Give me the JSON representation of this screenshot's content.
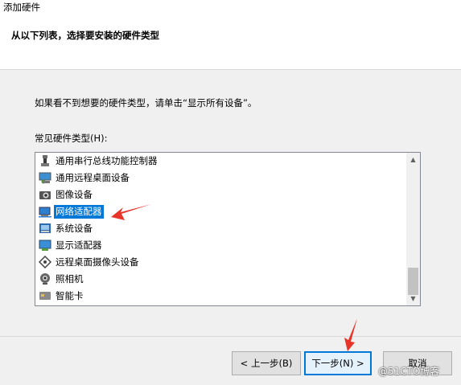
{
  "window": {
    "title": "添加硬件"
  },
  "header": {
    "title": "从以下列表，选择要安装的硬件类型"
  },
  "instruction": "如果看不到想要的硬件类型，请单击“显示所有设备”。",
  "list": {
    "label": "常见硬件类型(H):",
    "items": [
      {
        "label": "通用串行总线功能控制器",
        "icon": "usb-controller-icon"
      },
      {
        "label": "通用远程桌面设备",
        "icon": "remote-desktop-device-icon"
      },
      {
        "label": "图像设备",
        "icon": "imaging-device-icon"
      },
      {
        "label": "网络适配器",
        "icon": "network-adapter-icon",
        "selected": true
      },
      {
        "label": "系统设备",
        "icon": "system-device-icon"
      },
      {
        "label": "显示适配器",
        "icon": "display-adapter-icon"
      },
      {
        "label": "远程桌面摄像头设备",
        "icon": "remote-camera-icon"
      },
      {
        "label": "照相机",
        "icon": "camera-icon"
      },
      {
        "label": "智能卡",
        "icon": "smart-card-icon"
      }
    ]
  },
  "buttons": {
    "back": "< 上一步(B)",
    "next": "下一步(N) >",
    "cancel": "取消"
  },
  "watermark": "@51CTO博客",
  "colors": {
    "selection": "#0078d7",
    "annotation_arrow": "#e8352a",
    "default_button_border": "#0078d7"
  }
}
